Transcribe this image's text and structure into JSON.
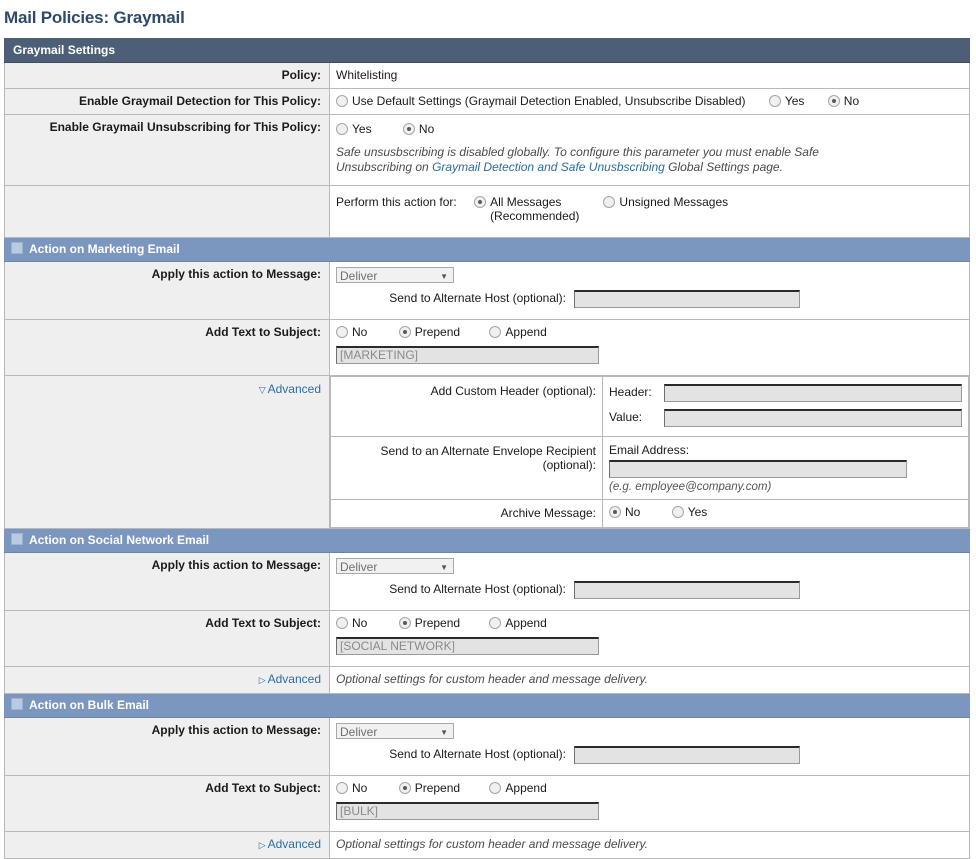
{
  "page": {
    "title": "Mail Policies: Graymail"
  },
  "panel": {
    "header": "Graymail Settings",
    "policy_label": "Policy:",
    "policy_value": "Whitelisting",
    "detection_label": "Enable Graymail Detection for This Policy:",
    "detection_options": [
      "Use Default Settings (Graymail Detection Enabled, Unsubscribe Disabled)",
      "Yes",
      "No"
    ],
    "detection_selected": "No",
    "unsub_label": "Enable Graymail Unsubscribing for This Policy:",
    "unsub_options": [
      "Yes",
      "No"
    ],
    "unsub_selected": "No",
    "unsub_note_part1": "Safe unsusbscribing is disabled globally. To configure this parameter you must enable Safe Unsubscribing on ",
    "unsub_note_link": "Graymail Detection and Safe Unusbscribing",
    "unsub_note_part2": " Global Settings page.",
    "perform_label": "Perform this action for:",
    "perform_options": [
      "All Messages (Recommended)",
      "Unsigned Messages"
    ],
    "perform_selected": "All Messages (Recommended)"
  },
  "marketing": {
    "header": "Action on Marketing Email",
    "apply_label": "Apply this action to Message:",
    "apply_value": "Deliver",
    "alt_host_label": "Send to Alternate Host (optional):",
    "alt_host_value": "",
    "subject_label": "Add Text to Subject:",
    "subject_options": [
      "No",
      "Prepend",
      "Append"
    ],
    "subject_selected": "Prepend",
    "subject_text": "[MARKETING]",
    "advanced_label": "Advanced",
    "advanced_state": "expanded",
    "custom_header_label": "Add Custom Header (optional):",
    "header_field_label": "Header:",
    "header_field_value": "",
    "value_field_label": "Value:",
    "value_field_value": "",
    "alt_recipient_label_line1": "Send to an Alternate Envelope Recipient",
    "alt_recipient_label_line2": "(optional):",
    "email_label": "Email Address:",
    "email_value": "",
    "email_hint": "(e.g. employee@company.com)",
    "archive_label": "Archive Message:",
    "archive_options": [
      "No",
      "Yes"
    ],
    "archive_selected": "No"
  },
  "social": {
    "header": "Action on Social Network Email",
    "apply_label": "Apply this action to Message:",
    "apply_value": "Deliver",
    "alt_host_label": "Send to Alternate Host (optional):",
    "alt_host_value": "",
    "subject_label": "Add Text to Subject:",
    "subject_options": [
      "No",
      "Prepend",
      "Append"
    ],
    "subject_selected": "Prepend",
    "subject_text": "[SOCIAL NETWORK]",
    "advanced_label": "Advanced",
    "advanced_state": "collapsed",
    "advanced_note": "Optional settings for custom header and message delivery."
  },
  "bulk": {
    "header": "Action on Bulk Email",
    "apply_label": "Apply this action to Message:",
    "apply_value": "Deliver",
    "alt_host_label": "Send to Alternate Host (optional):",
    "alt_host_value": "",
    "subject_label": "Add Text to Subject:",
    "subject_options": [
      "No",
      "Prepend",
      "Append"
    ],
    "subject_selected": "Prepend",
    "subject_text": "[BULK]",
    "advanced_label": "Advanced",
    "advanced_state": "collapsed",
    "advanced_note": "Optional settings for custom header and message delivery."
  },
  "colors": {
    "panel_header_bg": "#4c5f77",
    "section_header_bg": "#7b97c0",
    "title_color": "#2e4a68",
    "link_color": "#2b6ca3",
    "label_bg": "#efefef"
  }
}
